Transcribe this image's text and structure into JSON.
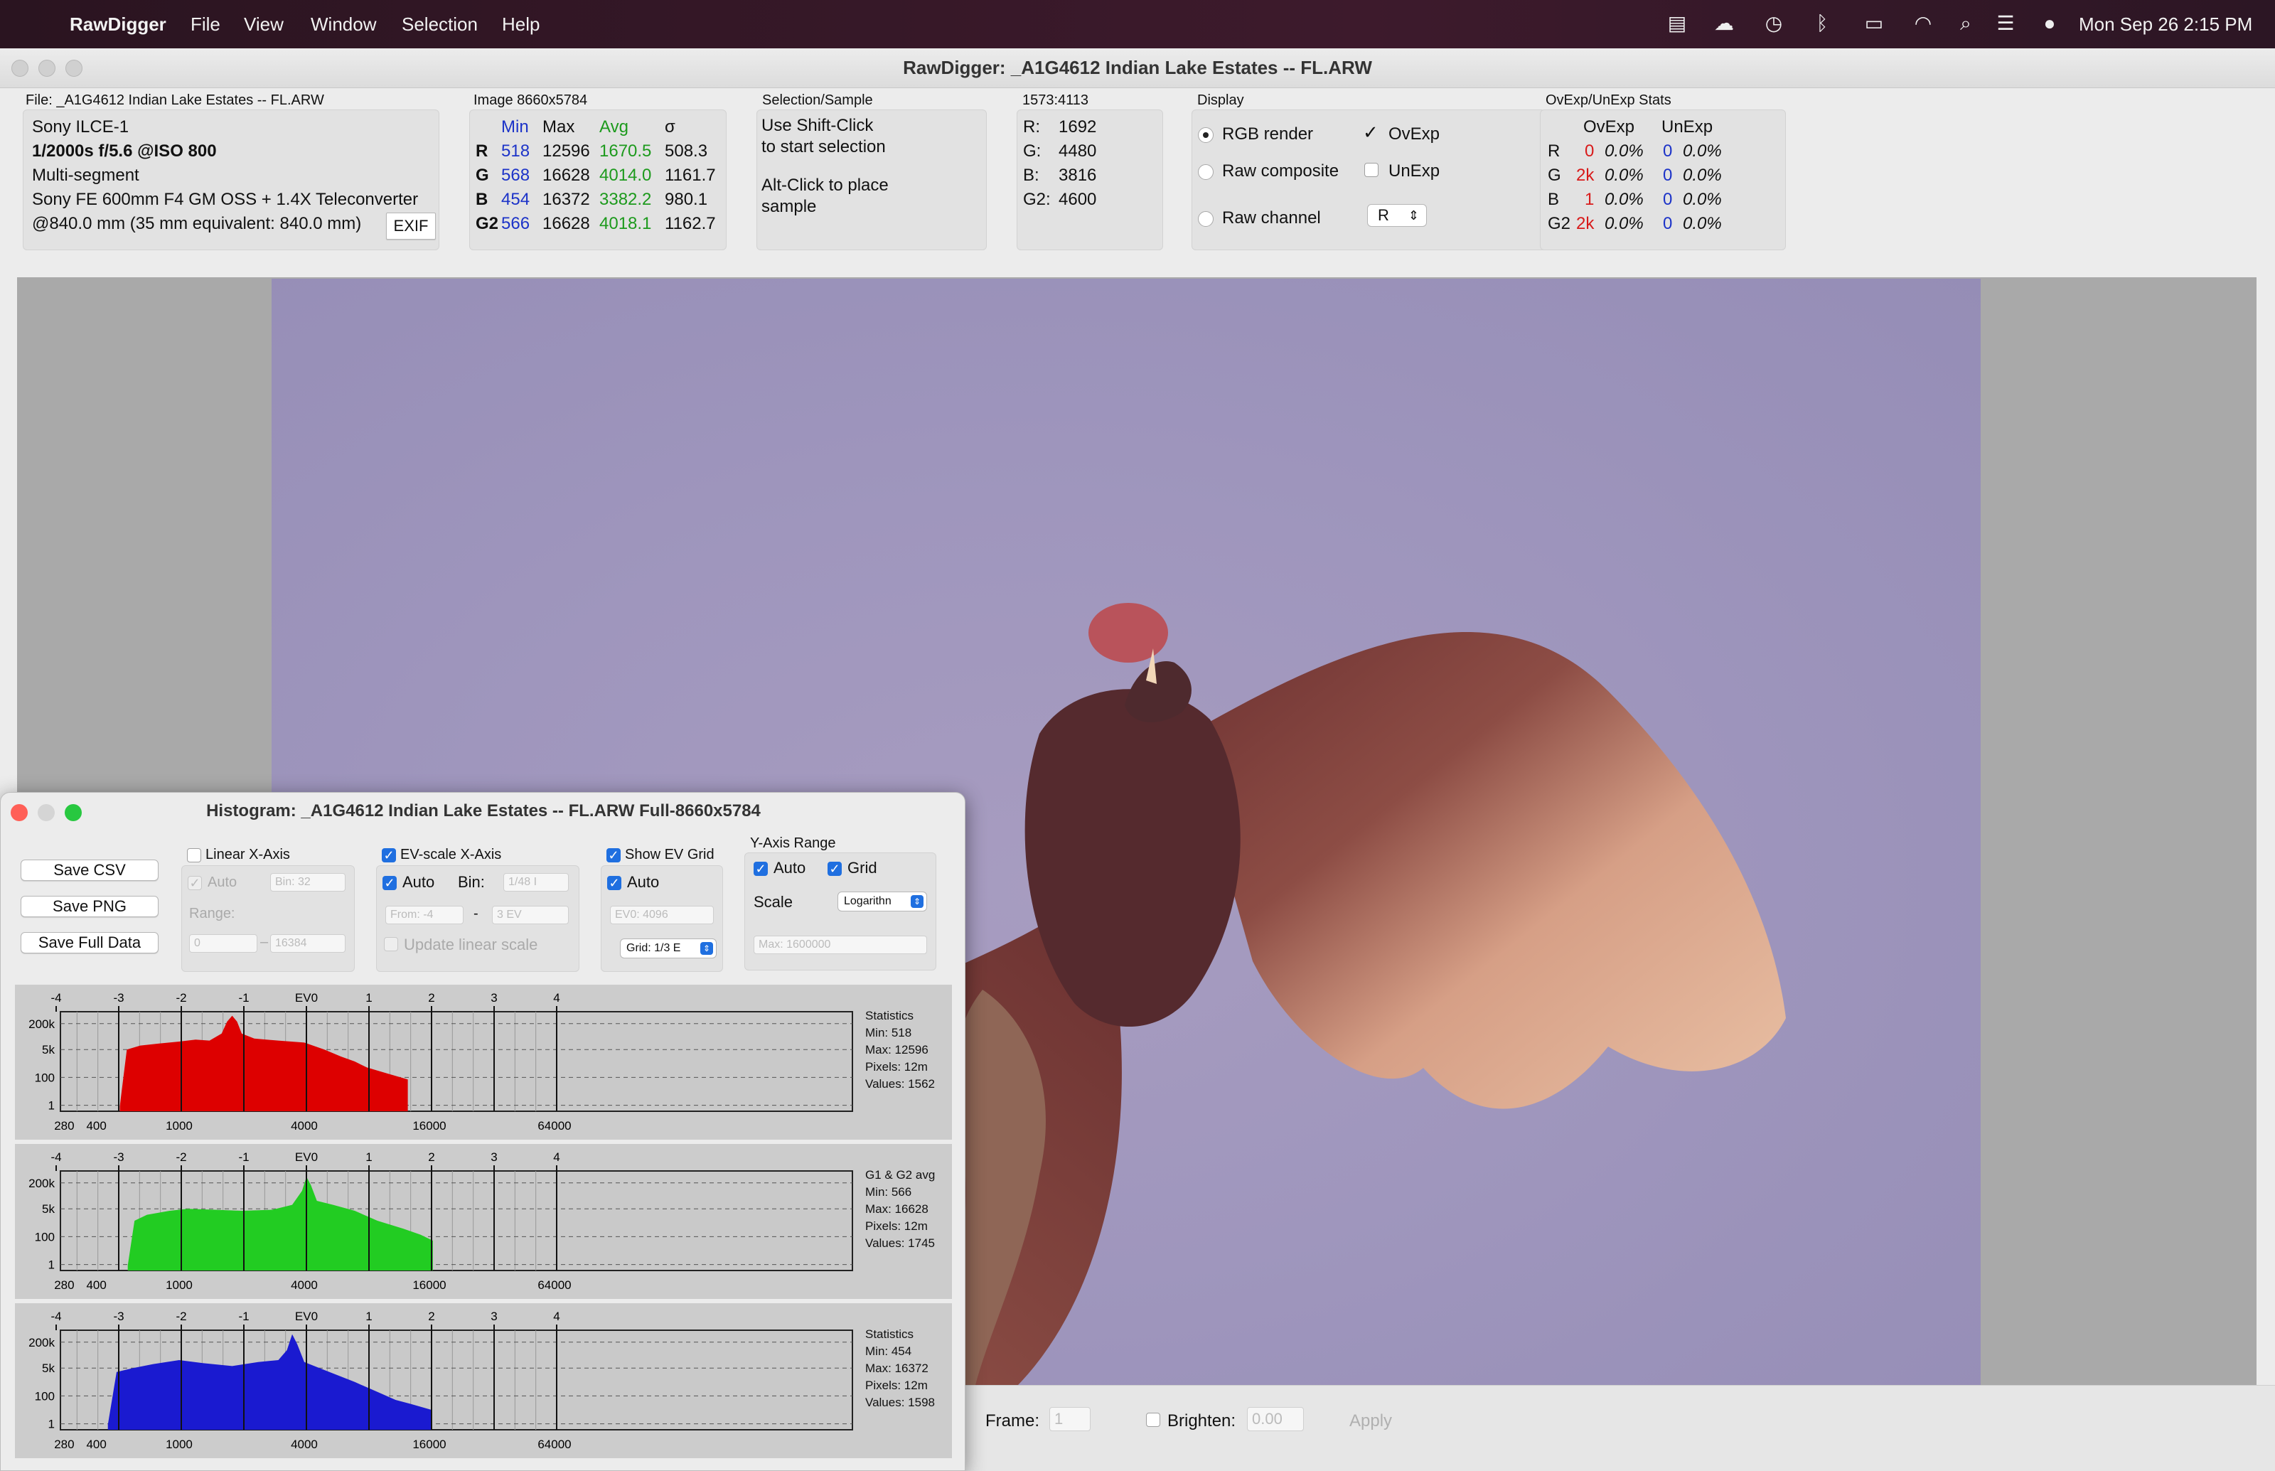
{
  "menubar": {
    "app": "RawDigger",
    "items": [
      "File",
      "View",
      "Window",
      "Selection",
      "Help"
    ],
    "clock": "Mon Sep 26  2:15 PM"
  },
  "window": {
    "title": "RawDigger: _A1G4612  Indian Lake Estates -- FL.ARW"
  },
  "file": {
    "label": "File: _A1G4612  Indian Lake Estates -- FL.ARW",
    "camera": "Sony ILCE-1",
    "exposure": "1/2000s f/5.6 @ISO 800",
    "mode": "Multi-segment",
    "lens": "Sony FE 600mm F4 GM OSS + 1.4X Teleconverter",
    "focal": "@840.0 mm (35 mm equivalent: 840.0 mm)",
    "exif_button": "EXIF"
  },
  "image": {
    "label": "Image 8660x5784",
    "headers": [
      "Min",
      "Max",
      "Avg",
      "σ"
    ],
    "rows": [
      [
        "R",
        "518",
        "12596",
        "1670.5",
        "508.3"
      ],
      [
        "G",
        "568",
        "16628",
        "4014.0",
        "1161.7"
      ],
      [
        "B",
        "454",
        "16372",
        "3382.2",
        "980.1"
      ],
      [
        "G2",
        "566",
        "16628",
        "4018.1",
        "1162.7"
      ]
    ]
  },
  "selection": {
    "label": "Selection/Sample",
    "line1": "Use Shift-Click",
    "line2": "to start selection",
    "line3": "Alt-Click to place",
    "line4": "sample"
  },
  "sample": {
    "label": "1573:4113",
    "rows": [
      [
        "R:",
        "1692"
      ],
      [
        "G:",
        "4480"
      ],
      [
        "B:",
        "3816"
      ],
      [
        "G2:",
        "4600"
      ]
    ]
  },
  "display": {
    "label": "Display",
    "rgb": "RGB render",
    "raw_composite": "Raw composite",
    "raw_channel": "Raw channel",
    "ovexp": "OvExp",
    "unexp": "UnExp",
    "channel": "R"
  },
  "ovexp": {
    "label": "OvExp/UnExp Stats",
    "h1": "OvExp",
    "h2": "UnExp",
    "rows": [
      [
        "R",
        "0",
        "0.0%",
        "0",
        "0.0%"
      ],
      [
        "G",
        "2k",
        "0.0%",
        "0",
        "0.0%"
      ],
      [
        "B",
        "1",
        "0.0%",
        "0",
        "0.0%"
      ],
      [
        "G2",
        "2k",
        "0.0%",
        "0",
        "0.0%"
      ]
    ]
  },
  "bottom": {
    "frame_label": "Frame:",
    "frame_value": "1",
    "brighten_label": "Brighten:",
    "brighten_value": "0.00",
    "apply": "Apply"
  },
  "histogram": {
    "title": "Histogram: _A1G4612  Indian Lake Estates -- FL.ARW Full-8660x5784",
    "buttons": {
      "save_csv": "Save CSV",
      "save_png": "Save PNG",
      "save_full": "Save Full Data"
    },
    "linear": {
      "label": "Linear X-Axis",
      "auto": "Auto",
      "bin": "Bin: 32",
      "range": "Range:",
      "from": "0",
      "to": "16384"
    },
    "ev": {
      "label": "EV-scale X-Axis",
      "auto": "Auto",
      "bin_label": "Bin:",
      "bin": "1/48 I",
      "from": "From: -4",
      "to": "3 EV",
      "update": "Update linear scale"
    },
    "grid": {
      "label": "Show EV Grid",
      "auto": "Auto",
      "ev0": "EV0: 4096",
      "grid": "Grid: 1/3 E"
    },
    "yaxis": {
      "label": "Y-Axis Range",
      "auto": "Auto",
      "grid": "Grid",
      "scale": "Scale",
      "scale_value": "Logarithn",
      "max": "Max: 1600000"
    },
    "ev_ticks": [
      "-4",
      "-3",
      "-2",
      "-1",
      "EV0",
      "1",
      "2",
      "3",
      "4"
    ],
    "x_ticks": [
      "280",
      "400",
      "1000",
      "4000",
      "16000",
      "64000"
    ],
    "y_ticks": [
      "200k",
      "5k",
      "100",
      "1"
    ],
    "channels": [
      {
        "name": "R",
        "color": "#dd0000",
        "stats": [
          "Statistics",
          "Min: 518",
          "Max: 12596",
          "Pixels: 12m",
          "Values: 1562"
        ],
        "points": [
          [
            518,
            0.05
          ],
          [
            560,
            0.62
          ],
          [
            650,
            0.66
          ],
          [
            800,
            0.68
          ],
          [
            1000,
            0.7
          ],
          [
            1200,
            0.72
          ],
          [
            1400,
            0.71
          ],
          [
            1600,
            0.78
          ],
          [
            1700,
            0.9
          ],
          [
            1800,
            0.96
          ],
          [
            1900,
            0.9
          ],
          [
            2000,
            0.78
          ],
          [
            2300,
            0.73
          ],
          [
            3000,
            0.71
          ],
          [
            4000,
            0.69
          ],
          [
            5000,
            0.62
          ],
          [
            6000,
            0.55
          ],
          [
            7000,
            0.5
          ],
          [
            8000,
            0.44
          ],
          [
            10000,
            0.38
          ],
          [
            12596,
            0.32
          ]
        ]
      },
      {
        "name": "G",
        "color": "#22cc22",
        "stats": [
          "G1 & G2 avg",
          "Min: 566",
          "Max: 16628",
          "Pixels: 12m",
          "Values: 1745"
        ],
        "points": [
          [
            566,
            0.05
          ],
          [
            610,
            0.5
          ],
          [
            700,
            0.56
          ],
          [
            900,
            0.6
          ],
          [
            1100,
            0.62
          ],
          [
            1500,
            0.61
          ],
          [
            2000,
            0.6
          ],
          [
            2800,
            0.61
          ],
          [
            3500,
            0.66
          ],
          [
            3900,
            0.8
          ],
          [
            4100,
            0.94
          ],
          [
            4300,
            0.86
          ],
          [
            4600,
            0.7
          ],
          [
            5500,
            0.66
          ],
          [
            7000,
            0.6
          ],
          [
            9000,
            0.5
          ],
          [
            12000,
            0.42
          ],
          [
            14500,
            0.36
          ],
          [
            16628,
            0.3
          ]
        ]
      },
      {
        "name": "B",
        "color": "#1a1ad0",
        "stats": [
          "Statistics",
          "Min: 454",
          "Max: 16372",
          "Pixels: 12m",
          "Values: 1598"
        ],
        "points": [
          [
            454,
            0.05
          ],
          [
            500,
            0.58
          ],
          [
            600,
            0.62
          ],
          [
            750,
            0.66
          ],
          [
            1000,
            0.7
          ],
          [
            1300,
            0.67
          ],
          [
            1800,
            0.64
          ],
          [
            2400,
            0.68
          ],
          [
            3000,
            0.7
          ],
          [
            3300,
            0.8
          ],
          [
            3500,
            0.96
          ],
          [
            3700,
            0.86
          ],
          [
            4000,
            0.68
          ],
          [
            5000,
            0.6
          ],
          [
            7000,
            0.48
          ],
          [
            9000,
            0.38
          ],
          [
            11000,
            0.3
          ],
          [
            13000,
            0.26
          ],
          [
            16372,
            0.2
          ]
        ]
      }
    ]
  }
}
